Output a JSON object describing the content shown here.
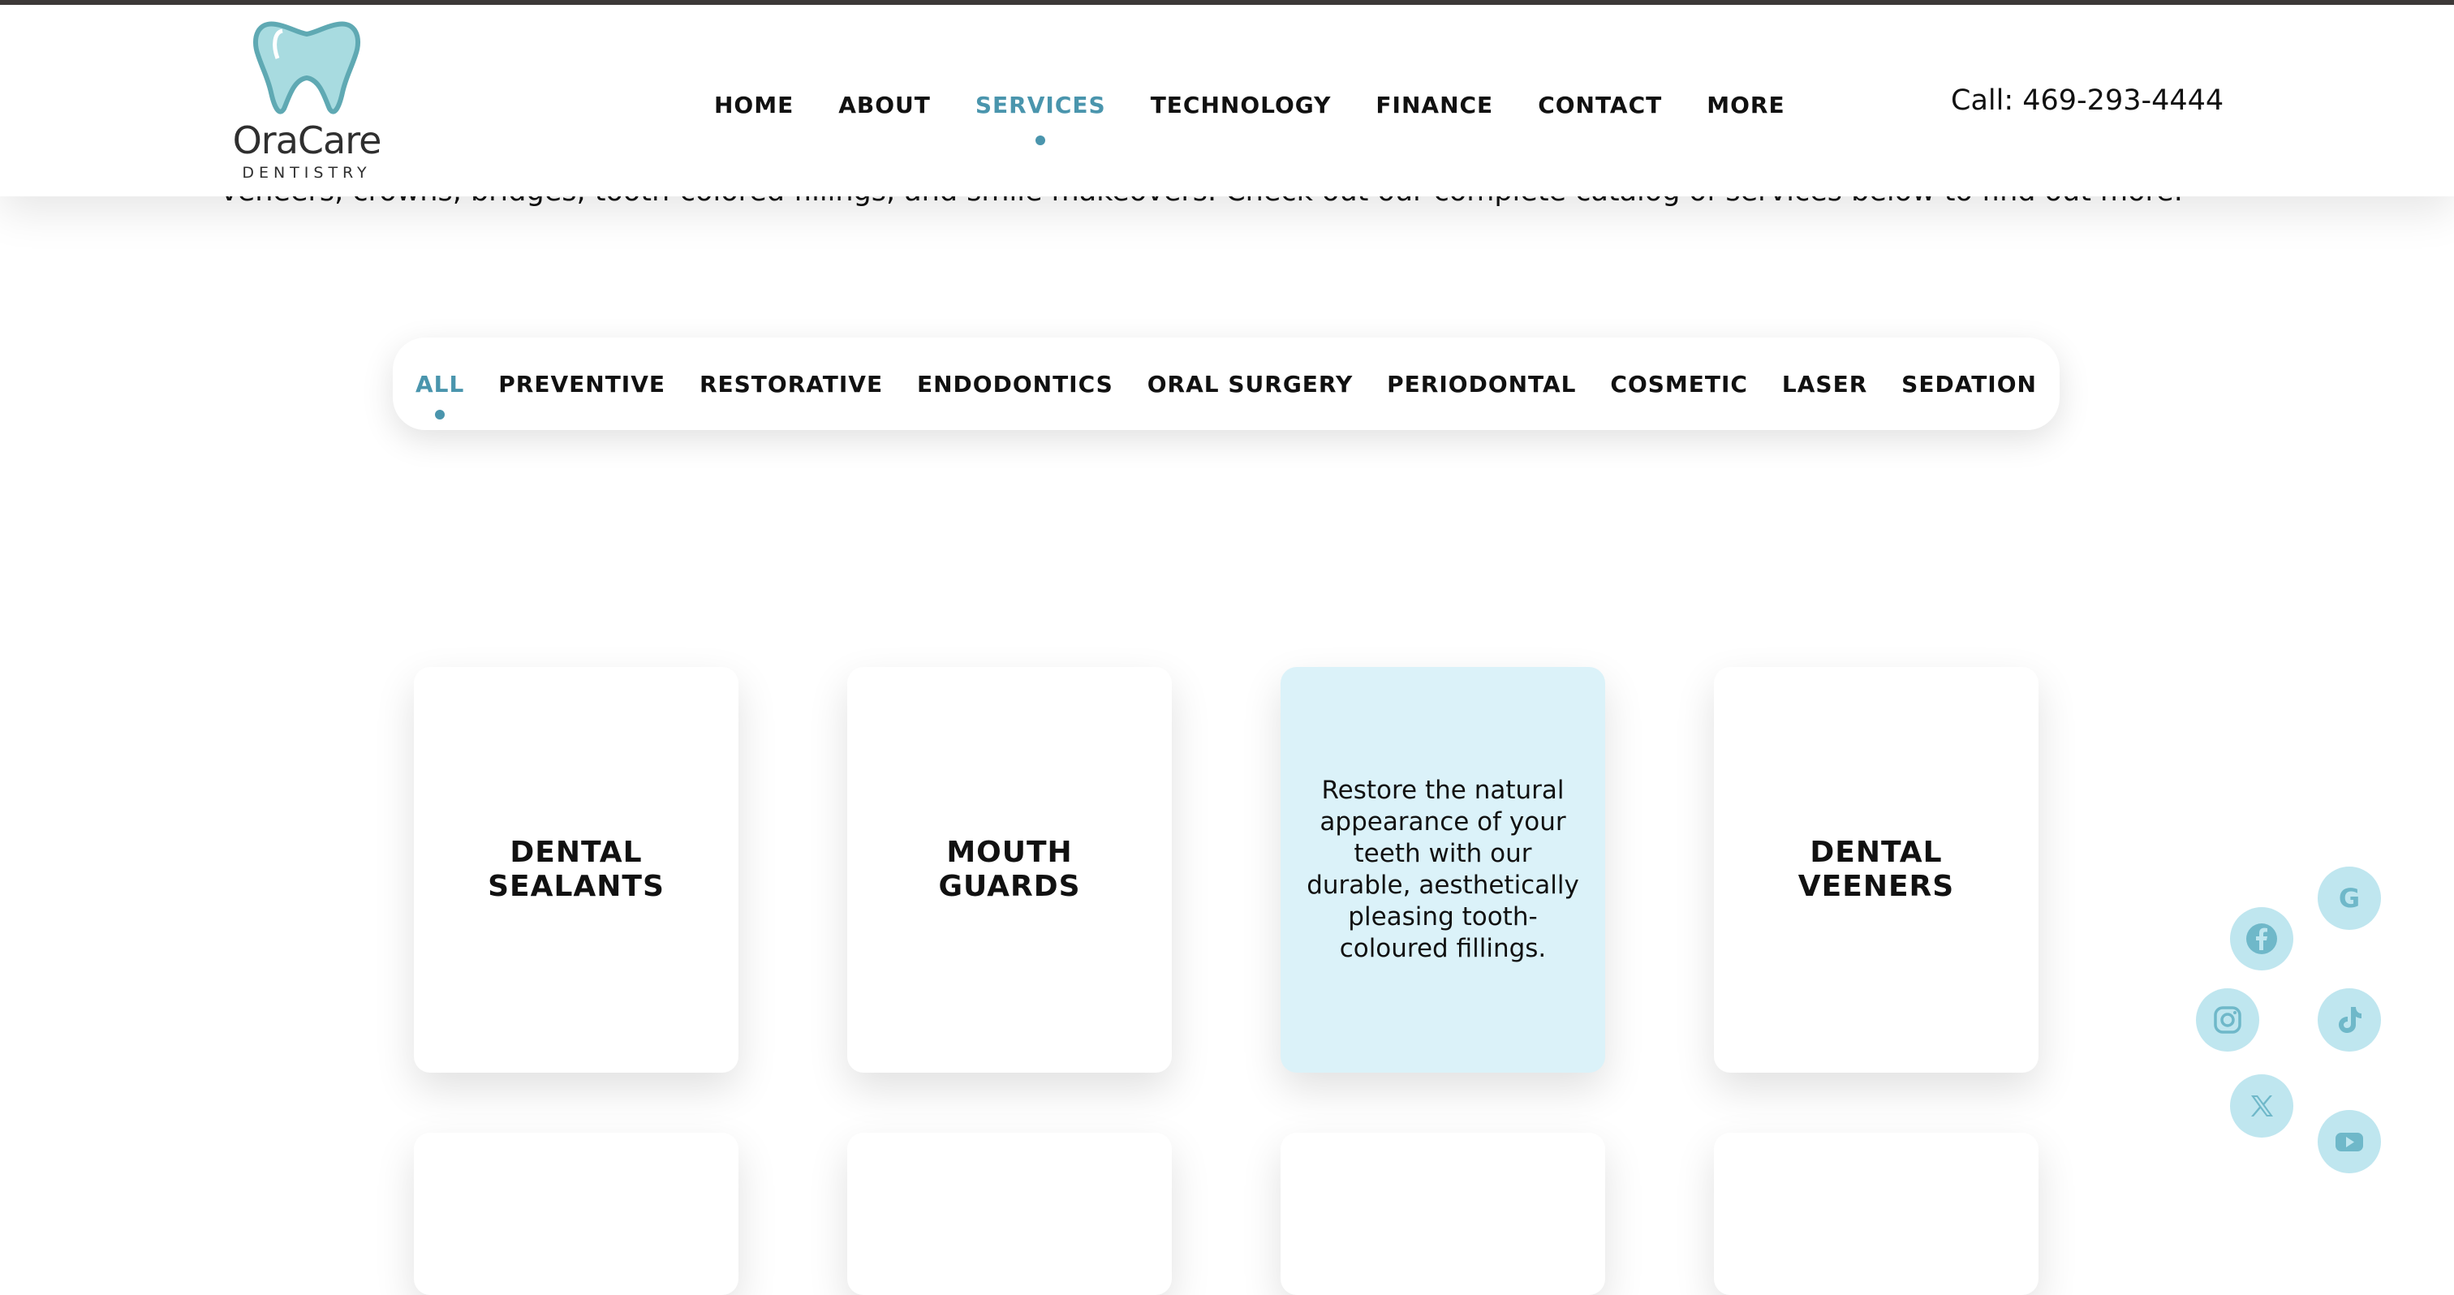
{
  "header": {
    "logo": {
      "name": "OraCare",
      "subtitle": "DENTISTRY"
    },
    "nav": [
      "HOME",
      "ABOUT",
      "SERVICES",
      "TECHNOLOGY",
      "FINANCE",
      "CONTACT",
      "MORE"
    ],
    "active_nav": "SERVICES",
    "phone": "Call: 469-293-4444"
  },
  "intro": {
    "text": "veneers, crowns, bridges, tooth-colored fillings, and smile makeovers. Check out our complete catalog of services below to find out more."
  },
  "filters": {
    "items": [
      "ALL",
      "PREVENTIVE",
      "RESTORATIVE",
      "ENDODONTICS",
      "ORAL SURGERY",
      "PERIODONTAL",
      "COSMETIC",
      "LASER",
      "SEDATION"
    ],
    "active": "ALL"
  },
  "cards": [
    {
      "title": "DENTAL SEALANTS"
    },
    {
      "title": "MOUTH GUARDS"
    },
    {
      "description": "Restore the natural appearance of your teeth with our durable, aesthetically pleasing tooth-coloured fillings."
    },
    {
      "title": "DENTAL VEENERS"
    }
  ],
  "social": [
    "google-icon",
    "facebook-icon",
    "instagram-icon",
    "tiktok-icon",
    "x-icon",
    "youtube-icon"
  ],
  "colors": {
    "accent": "#4a95ad",
    "card_hover": "#dbf2f9",
    "social_bg": "#bfe6ef",
    "social_icon": "#6fb8c9"
  }
}
